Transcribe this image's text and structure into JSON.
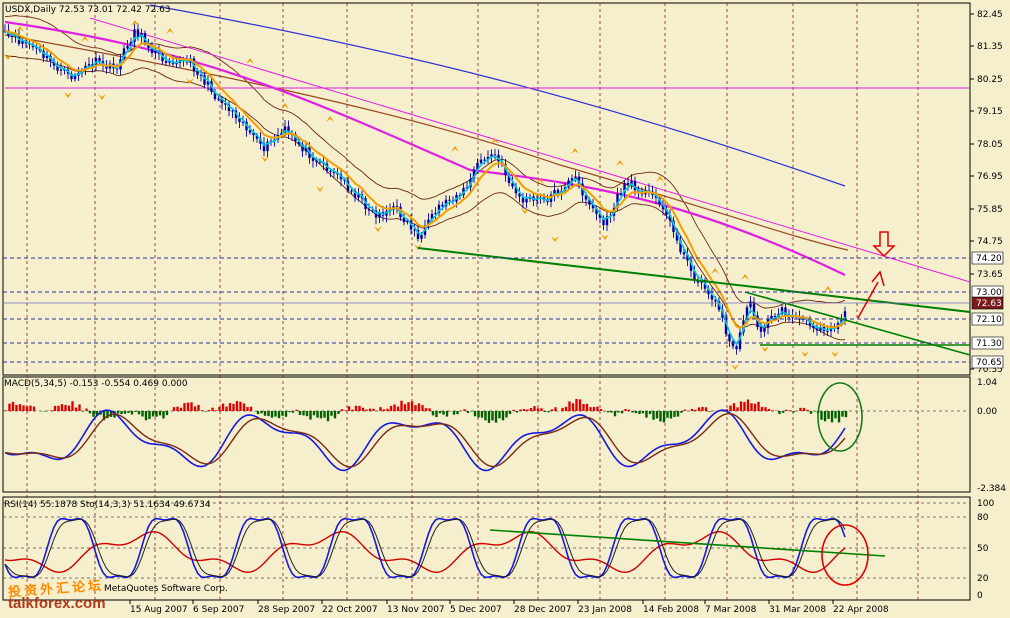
{
  "main_panel": {
    "header": "USDX,Daily  72.53 73.01 72.42 72.63",
    "price_ticks": [
      "82.45",
      "81.35",
      "80.25",
      "79.15",
      "78.05",
      "76.95",
      "75.85",
      "74.75",
      "73.65",
      "70.35"
    ],
    "price_labels": [
      {
        "text": "74.20",
        "style": "box"
      },
      {
        "text": "73.00",
        "style": "box"
      },
      {
        "text": "72.63",
        "style": "current"
      },
      {
        "text": "72.10",
        "style": "box"
      },
      {
        "text": "71.30",
        "style": "box"
      },
      {
        "text": "70.65",
        "style": "box"
      }
    ]
  },
  "macd_panel": {
    "header": "MACD(5,34,5) -0.153 -0.554 0.469 0.000",
    "ticks": [
      "1.04",
      "0.00",
      "-2.384"
    ]
  },
  "rsi_panel": {
    "header": "RSI(14) 55.1878  Sto(14,3,3) 51.1634 49.6734",
    "ticks": [
      "100",
      "80",
      "50",
      "20",
      "0"
    ],
    "footer_fragment": "MetaQuotes Software Corp."
  },
  "dates": [
    "15 Aug 2007",
    "6 Sep 2007",
    "28 Sep 2007",
    "22 Oct 2007",
    "13 Nov 2007",
    "5 Dec 2007",
    "28 Dec 2007",
    "23 Jan 2008",
    "14 Feb 2008",
    "7 Mar 2008",
    "31 Mar 2008",
    "22 Apr 2008"
  ],
  "watermark": {
    "cn": "投资外汇论坛",
    "en": "talkforex.com"
  },
  "colors": {
    "background": "#f5efce",
    "candle": "#0000aa",
    "ema_fast": "#00c8e0",
    "ema_mid": "#f0a000",
    "ema_slow": "#e020e0",
    "ma_long": "#3030d0",
    "bollinger": "#6a2a10",
    "trendline": "#008000",
    "hist_up": "#e00000",
    "hist_down": "#006000",
    "oscillator": "#1818e0",
    "signal": "#7a2a10",
    "rsi": "#d00000",
    "annotation": "#e00000",
    "highlight_circle": "#1a7a1a"
  }
}
